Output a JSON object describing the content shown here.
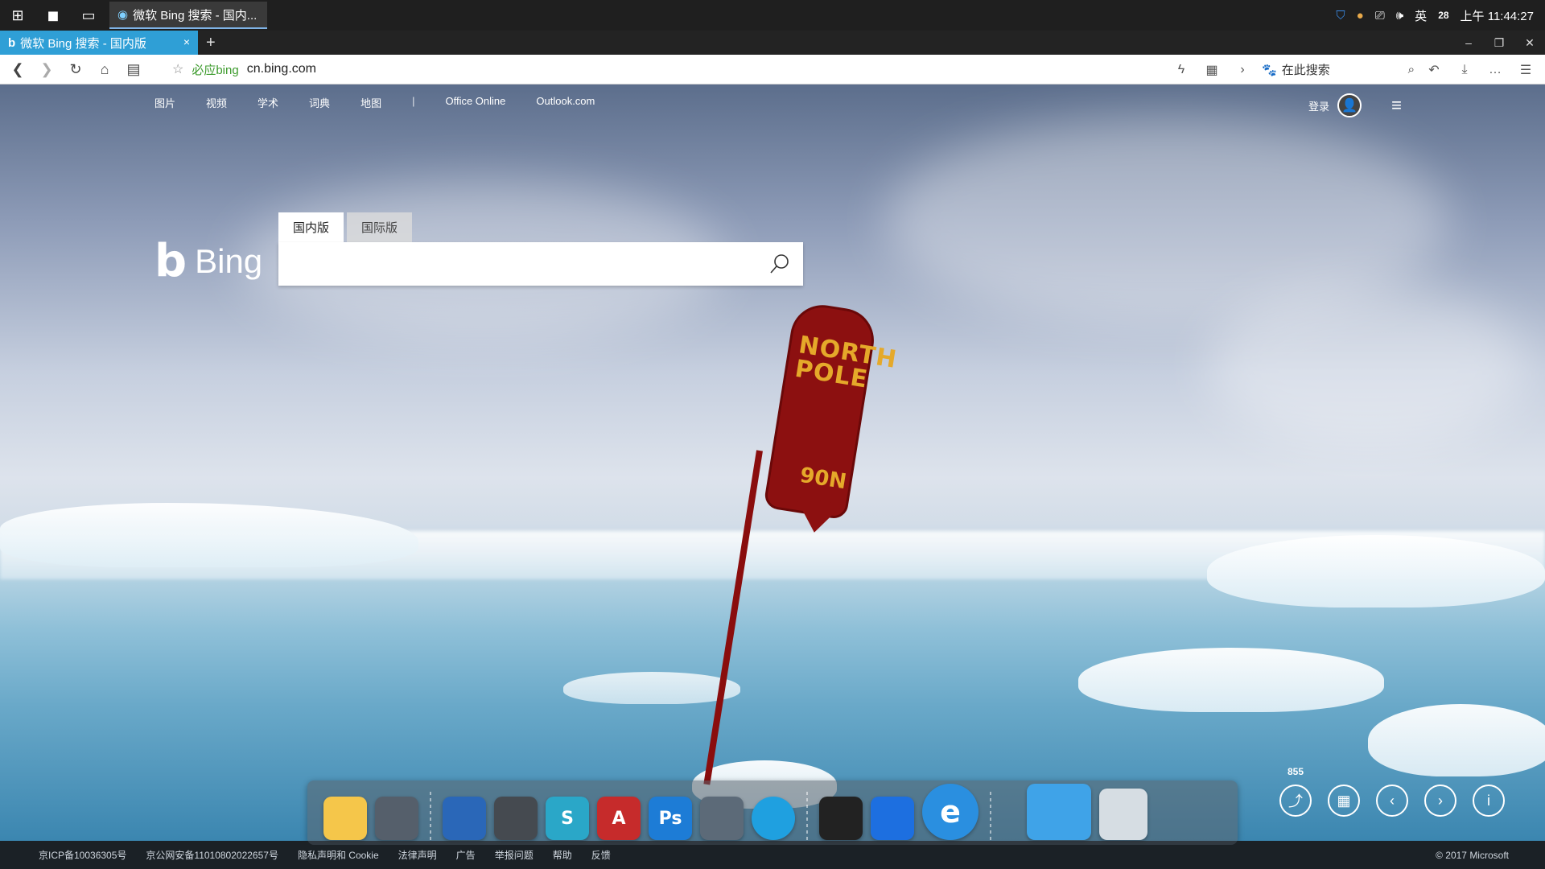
{
  "os_taskbar": {
    "task_title": "微软 Bing 搜索 - 国内...",
    "tray": {
      "lang": "英",
      "badge": "28",
      "time": "上午 11:44:27"
    }
  },
  "browser": {
    "tab_title": "微软 Bing 搜索 - 国内版",
    "tab_close": "×",
    "tab_add": "+",
    "win_min": "–",
    "win_restore": "❐",
    "win_close": "✕",
    "secure_label": "必应bing",
    "url": "cn.bing.com",
    "search_placeholder": "在此搜索"
  },
  "bing": {
    "nav": [
      "图片",
      "视频",
      "学术",
      "词典",
      "地图"
    ],
    "nav_sep": "|",
    "nav_extra": [
      "Office Online",
      "Outlook.com"
    ],
    "login": "登录",
    "logo_text": "Bing",
    "search_tabs": [
      "国内版",
      "国际版"
    ],
    "search_value": ""
  },
  "sign": {
    "main_text": "NORTH POLE",
    "sub_text": "90N"
  },
  "dock": {
    "apps": [
      {
        "name": "file-explorer",
        "label": ""
      },
      {
        "name": "system-settings",
        "label": ""
      },
      {
        "name": "remote-desktop",
        "label": ""
      },
      {
        "name": "dark-app",
        "label": ""
      },
      {
        "name": "3dsmax",
        "label": "S"
      },
      {
        "name": "autocad-ws",
        "label": "A"
      },
      {
        "name": "photoshop",
        "label": "Ps"
      },
      {
        "name": "server-manager",
        "label": ""
      },
      {
        "name": "browser",
        "label": ""
      },
      {
        "name": "qq",
        "label": ""
      },
      {
        "name": "feishu",
        "label": ""
      },
      {
        "name": "ie",
        "label": "e"
      },
      {
        "name": "computer",
        "label": ""
      },
      {
        "name": "recycle-bin",
        "label": ""
      }
    ]
  },
  "image_controls": {
    "count": "855"
  },
  "footer": {
    "links": [
      "京ICP备10036305号",
      "京公网安备11010802022657号",
      "隐私声明和 Cookie",
      "法律声明",
      "广告",
      "举报问题",
      "帮助",
      "反馈"
    ],
    "copyright": "© 2017 Microsoft"
  },
  "colors": {
    "tab_active": "#2f9fd6",
    "os_bar": "#1f1f1f",
    "secure_green": "#3b9a2b",
    "sign_red": "#8c1010",
    "sign_text": "#e5a92a"
  }
}
